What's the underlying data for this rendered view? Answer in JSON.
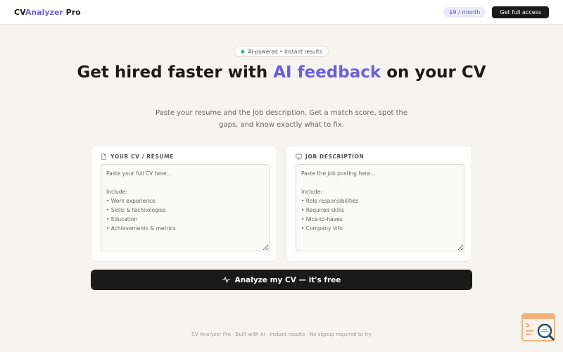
{
  "header": {
    "logo_part1": "CV",
    "logo_part2": "Analyzer",
    "logo_part3": " Pro",
    "price": "$9 / month",
    "cta": "Get full access"
  },
  "hero": {
    "pill": "AI-powered • Instant results",
    "headline_part1": "Get hired faster with ",
    "headline_highlight": "AI feedback",
    "headline_part2": " on your CV",
    "subhead": "Paste your resume and the job description. Get a match score, spot the gaps, and know exactly what to fix."
  },
  "cv_card": {
    "label": "YOUR CV / RESUME",
    "placeholder": "Paste your full CV here...\n\nInclude:\n• Work experience\n• Skills & technologies\n• Education\n• Achievements & metrics"
  },
  "job_card": {
    "label": "JOB DESCRIPTION",
    "placeholder": "Paste the job posting here...\n\nInclude:\n• Role responsibilities\n• Required skills\n• Nice-to-haves\n• Company info"
  },
  "analyze_button": "Analyze my CV — it's free",
  "footer": "CV Analyzer Pro · Built with AI · Instant results · No signup required to try",
  "colors": {
    "accent": "#6b5fdc",
    "dark": "#1a1a1a",
    "background": "#f5f4f0",
    "status_dot": "#22c55e"
  }
}
